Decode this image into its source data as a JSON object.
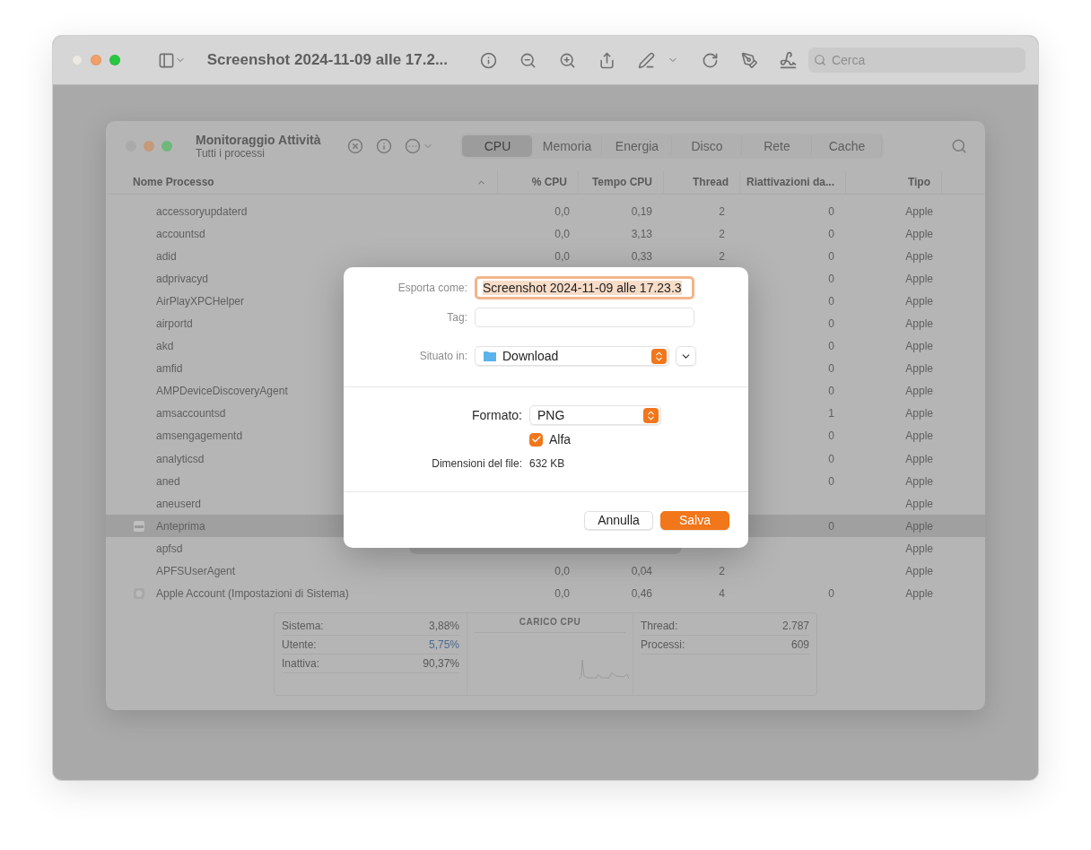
{
  "viewer": {
    "title": "Screenshot 2024-11-09 alle 17.2...",
    "search": {
      "placeholder": "Cerca"
    }
  },
  "monitor": {
    "title": "Monitoraggio Attività",
    "subtitle": "Tutti i processi",
    "tabs": [
      {
        "label": "CPU",
        "selected": true
      },
      {
        "label": "Memoria",
        "selected": false
      },
      {
        "label": "Energia",
        "selected": false
      },
      {
        "label": "Disco",
        "selected": false
      },
      {
        "label": "Rete",
        "selected": false
      },
      {
        "label": "Cache",
        "selected": false
      }
    ],
    "columns": [
      {
        "label": "Nome Processo",
        "sorted": true
      },
      {
        "label": "% CPU",
        "sorted": false
      },
      {
        "label": "Tempo CPU",
        "sorted": false
      },
      {
        "label": "Thread",
        "sorted": false
      },
      {
        "label": "Riattivazioni da...",
        "sorted": false
      },
      {
        "label": "Tipo",
        "sorted": false
      }
    ],
    "rows": [
      {
        "kind": "daemon",
        "selected": false,
        "name": "accessoryupdaterd",
        "cpu": "0,0",
        "time": "0,19",
        "threads": "2",
        "wakeups": "0",
        "type": "Apple"
      },
      {
        "kind": "daemon",
        "selected": false,
        "name": "accountsd",
        "cpu": "0,0",
        "time": "3,13",
        "threads": "2",
        "wakeups": "0",
        "type": "Apple"
      },
      {
        "kind": "daemon",
        "selected": false,
        "name": "adid",
        "cpu": "0,0",
        "time": "0,33",
        "threads": "2",
        "wakeups": "0",
        "type": "Apple"
      },
      {
        "kind": "daemon",
        "selected": false,
        "name": "adprivacyd",
        "wakeups": "0",
        "type": "Apple"
      },
      {
        "kind": "daemon",
        "selected": false,
        "name": "AirPlayXPCHelper",
        "wakeups": "0",
        "type": "Apple"
      },
      {
        "kind": "daemon",
        "selected": false,
        "name": "airportd",
        "wakeups": "0",
        "type": "Apple"
      },
      {
        "kind": "daemon",
        "selected": false,
        "name": "akd",
        "wakeups": "0",
        "type": "Apple"
      },
      {
        "kind": "daemon",
        "selected": false,
        "name": "amfid",
        "wakeups": "0",
        "type": "Apple"
      },
      {
        "kind": "daemon",
        "selected": false,
        "name": "AMPDeviceDiscoveryAgent",
        "wakeups": "0",
        "type": "Apple"
      },
      {
        "kind": "daemon",
        "selected": false,
        "name": "amsaccountsd",
        "wakeups": "1",
        "type": "Apple"
      },
      {
        "kind": "daemon",
        "selected": false,
        "name": "amsengagementd",
        "wakeups": "0",
        "type": "Apple"
      },
      {
        "kind": "daemon",
        "selected": false,
        "name": "analyticsd",
        "wakeups": "0",
        "type": "Apple"
      },
      {
        "kind": "daemon",
        "selected": false,
        "name": "aned",
        "wakeups": "0",
        "type": "Apple"
      },
      {
        "kind": "daemon",
        "selected": false,
        "name": "aneuserd",
        "type": "Apple"
      },
      {
        "kind": "viewer",
        "selected": true,
        "name": "Anteprima",
        "wakeups": "0",
        "type": "Apple"
      },
      {
        "kind": "daemon",
        "selected": false,
        "name": "apfsd",
        "type": "Apple"
      },
      {
        "kind": "daemon",
        "selected": false,
        "name": "APFSUserAgent",
        "cpu": "0,0",
        "time": "0,04",
        "threads": "2",
        "type": "Apple"
      },
      {
        "kind": "settings",
        "selected": false,
        "name": "Apple Account (Impostazioni di Sistema)",
        "cpu": "0,0",
        "time": "0,46",
        "threads": "4",
        "wakeups": "0",
        "type": "Apple"
      }
    ],
    "load": [
      {
        "label": "Sistema:",
        "value": "3,88%",
        "color": "#5a5a5a"
      },
      {
        "label": "Utente:",
        "value": "5,75%",
        "color": "#4f6a8f"
      },
      {
        "label": "Inattiva:",
        "value": "90,37%",
        "color": "#585858"
      }
    ],
    "chart_title": "CARICO CPU",
    "counts": [
      {
        "label": "Thread:",
        "value": "2.787"
      },
      {
        "label": "Processi:",
        "value": "609"
      }
    ]
  },
  "dialog": {
    "export_as": {
      "label": "Esporta come:",
      "value": "Screenshot 2024-11-09 alle 17.23.3",
      "text_selected": true
    },
    "tags": {
      "label": "Tag:"
    },
    "location": {
      "label": "Situato in:",
      "value": "Download"
    },
    "format": {
      "label": "Formato:",
      "value": "PNG"
    },
    "alpha": {
      "label": "Alfa",
      "checked": true
    },
    "file_size": {
      "label": "Dimensioni del file:",
      "value": "632 KB"
    },
    "buttons": [
      {
        "label": "Annulla",
        "kind": "cancel"
      },
      {
        "label": "Salva",
        "kind": "default"
      }
    ]
  }
}
